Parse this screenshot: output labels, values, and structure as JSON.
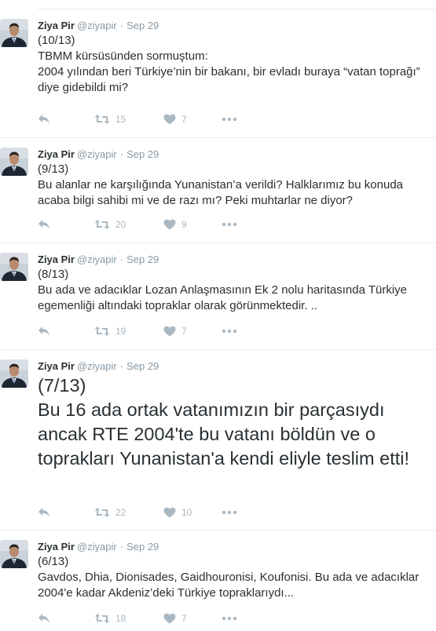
{
  "tweets": [
    {
      "name": "Ziya Pir",
      "handle": "@ziyapir",
      "separator": "·",
      "date": "Sep 29",
      "text": "(10/13)\nTBMM kürsüsünden sormuştum:\n2004 yılından beri Türkiye’nin bir bakanı, bir evladı buraya “vatan toprağı” diye gidebildi mi?",
      "retweets": "15",
      "likes": "7"
    },
    {
      "name": "Ziya Pir",
      "handle": "@ziyapir",
      "separator": "·",
      "date": "Sep 29",
      "text": "(9/13)\nBu alanlar ne karşılığında Yunanistan’a verildi? Halklarımız bu konuda acaba bilgi sahibi mi ve de razı mı? Peki muhtarlar ne diyor?",
      "retweets": "20",
      "likes": "9"
    },
    {
      "name": "Ziya Pir",
      "handle": "@ziyapir",
      "separator": "·",
      "date": "Sep 29",
      "text": "(8/13)\nBu ada ve adacıklar Lozan Anlaşmasının Ek 2 nolu haritasında Türkiye egemenliği altındaki topraklar olarak görünmektedir. ..",
      "retweets": "19",
      "likes": "7"
    },
    {
      "name": "Ziya Pir",
      "handle": "@ziyapir",
      "separator": "·",
      "date": "Sep 29",
      "text": "(7/13)\nBu 16 ada ortak vatanımızın bir parçasıydı ancak RTE 2004'te bu vatanı böldün ve o toprakları Yunanistan'a kendi eliyle teslim etti!",
      "retweets": "22",
      "likes": "10"
    },
    {
      "name": "Ziya Pir",
      "handle": "@ziyapir",
      "separator": "·",
      "date": "Sep 29",
      "text": "(6/13)\nGavdos, Dhia, Dionisades, Gaidhouronisi, Koufonisi. Bu ada ve adacıklar 2004'e kadar Akdeniz’deki Türkiye topraklarıydı...",
      "retweets": "18",
      "likes": "7"
    }
  ],
  "icons": {
    "reply": "reply-icon",
    "retweet": "retweet-icon",
    "like": "heart-icon",
    "more": "more-icon"
  },
  "colors": {
    "text": "#292f33",
    "meta": "#8899a6",
    "action": "#aab8c2",
    "divider": "#e6ecf0"
  }
}
